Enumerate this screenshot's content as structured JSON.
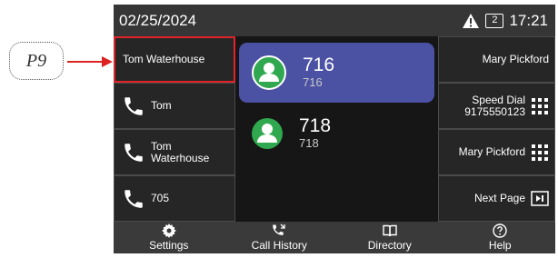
{
  "annotation": {
    "label": "P9"
  },
  "status_bar": {
    "date": "02/25/2024",
    "line_number": "2",
    "time": "17:21"
  },
  "left_keys": [
    {
      "label": "Tom Waterhouse",
      "icon": "none",
      "selected": true
    },
    {
      "label": "Tom",
      "icon": "phone-icon"
    },
    {
      "label": "Tom\nWaterhouse",
      "icon": "phone-icon"
    },
    {
      "label": "705",
      "icon": "phone-icon"
    }
  ],
  "right_keys": [
    {
      "label": "Mary Pickford",
      "icon": "none"
    },
    {
      "label": "Speed Dial\n9175550123",
      "icon": "keypad-icon"
    },
    {
      "label": "Mary Pickford",
      "icon": "keypad-icon"
    },
    {
      "label": "Next Page",
      "icon": "next-page-icon"
    }
  ],
  "calls": [
    {
      "number": "716",
      "sub": "716",
      "state": "active"
    },
    {
      "number": "718",
      "sub": "718",
      "state": "idle"
    }
  ],
  "softkeys": [
    {
      "label": "Settings",
      "icon": "gear-icon"
    },
    {
      "label": "Call History",
      "icon": "call-history-icon"
    },
    {
      "label": "Directory",
      "icon": "book-icon"
    },
    {
      "label": "Help",
      "icon": "help-icon"
    }
  ],
  "colors": {
    "selected_border": "#e0242a",
    "active_call": "#4b51a3",
    "avatar": "#2fa84f",
    "arrow": "#dd2222"
  }
}
